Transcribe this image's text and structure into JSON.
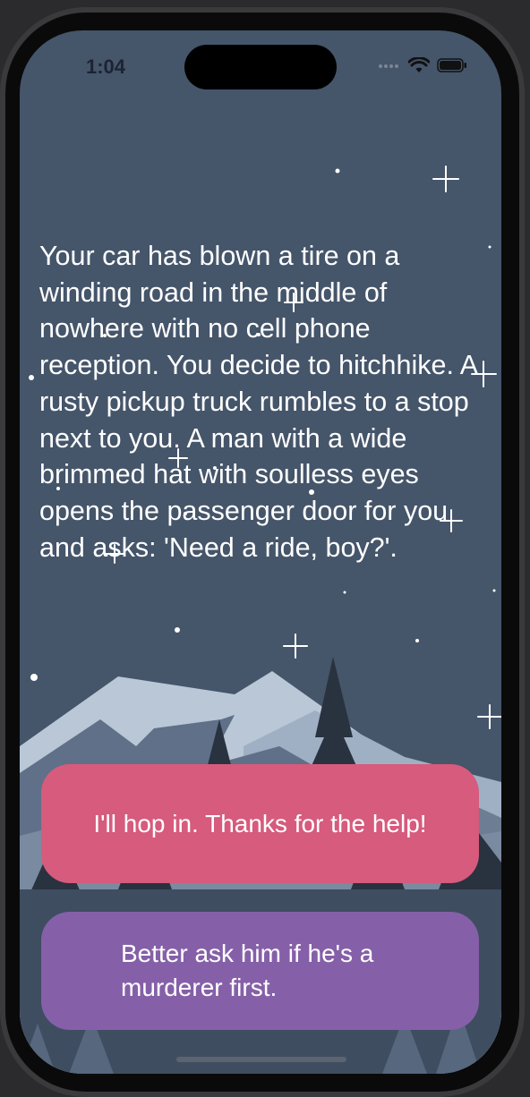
{
  "status_bar": {
    "time": "1:04"
  },
  "story": {
    "text": "Your car has blown a tire on a winding road in the middle of nowhere with no cell phone reception. You decide to hitchhike. A rusty pickup truck rumbles to a stop next to you. A man with a wide brimmed hat with soulless eyes opens the passenger door for you and asks: 'Need a ride, boy?'."
  },
  "choices": [
    {
      "label": "I'll hop in. Thanks for the help!",
      "color": "#d65b7d"
    },
    {
      "label": "Better ask him if he's a murderer first.",
      "color": "#8560a8"
    }
  ],
  "colors": {
    "sky": "#45556a",
    "mountain_light": "#b9c7d6",
    "mountain_mid": "#5f7088",
    "tree_dark": "#29323f"
  }
}
